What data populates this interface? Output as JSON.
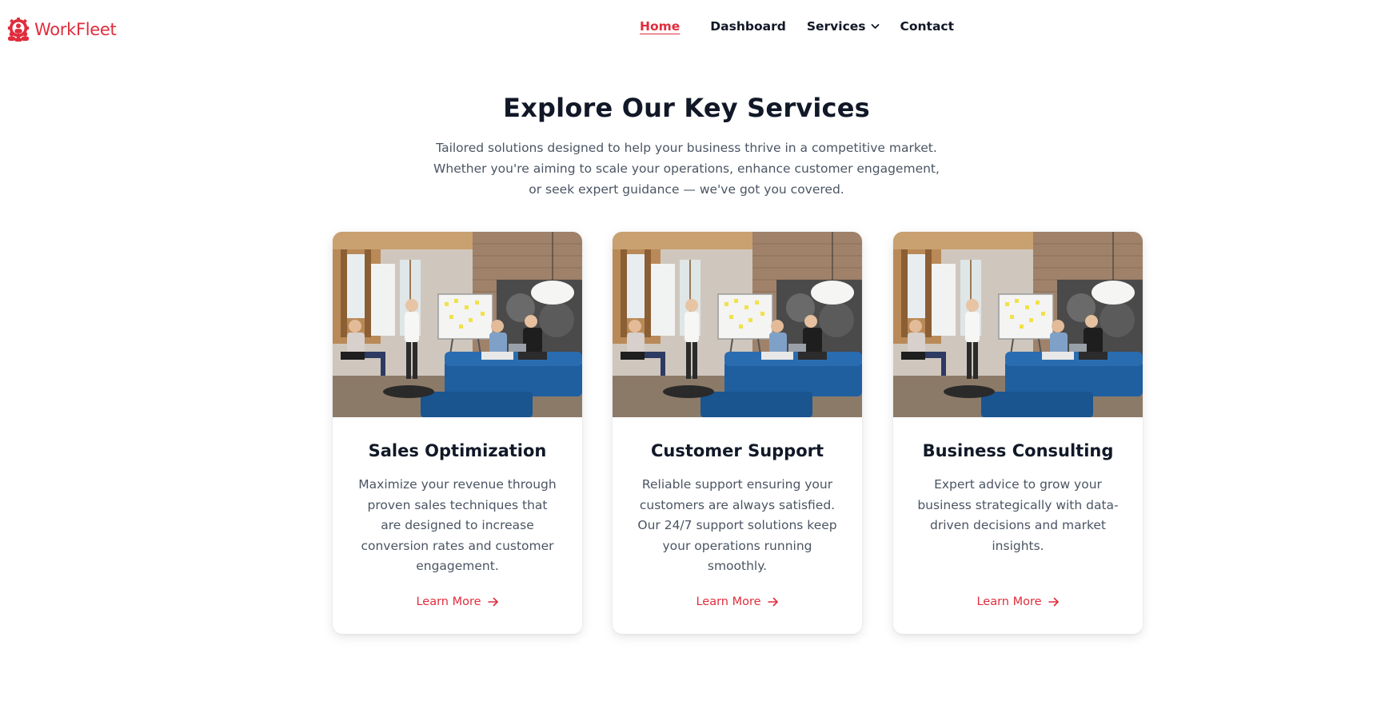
{
  "brand": {
    "name": "WorkFleet",
    "accent": "#e02d3c",
    "icon": "team-people-icon"
  },
  "nav": {
    "home": "Home",
    "dashboard": "Dashboard",
    "services": "Services",
    "contact": "Contact",
    "active": "Home"
  },
  "intro": {
    "title": "Explore Our Key Services",
    "subtitle": "Tailored solutions designed to help your business thrive in a competitive market. Whether you're aiming to scale your operations, enhance customer engagement, or seek expert guidance — we've got you covered."
  },
  "services": [
    {
      "title": "Sales Optimization",
      "description": "Maximize your revenue through proven sales techniques that are designed to increase conversion rates and customer engagement.",
      "link": "Learn More",
      "image": "team-meeting-office-photo"
    },
    {
      "title": "Customer Support",
      "description": "Reliable support ensuring your customers are always satisfied. Our 24/7 support solutions keep your operations running smoothly.",
      "link": "Learn More",
      "image": "team-meeting-office-photo"
    },
    {
      "title": "Business Consulting",
      "description": "Expert advice to grow your business strategically with data-driven decisions and market insights.",
      "link": "Learn More",
      "image": "team-meeting-office-photo"
    }
  ]
}
